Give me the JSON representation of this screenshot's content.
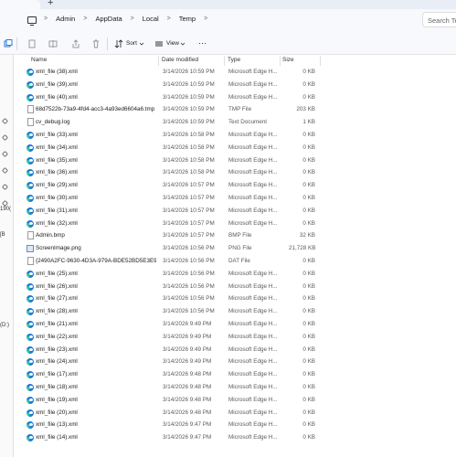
{
  "tabs": {
    "new_tab": "+"
  },
  "address": {
    "crumbs": [
      "Admin",
      "AppData",
      "Local",
      "Temp"
    ],
    "separator": ">",
    "search_placeholder": "Search Te"
  },
  "toolbar": {
    "sort_label": "Sort",
    "view_label": "View",
    "more_label": "···"
  },
  "gutter": {
    "snippets": [
      "190(",
      "[B",
      "(D:)"
    ]
  },
  "columns": {
    "name": "Name",
    "date": "Date modified",
    "type": "Type",
    "size": "Size"
  },
  "files": [
    {
      "name": "xml_file (38).xml",
      "date": "3/14/2026 10:59 PM",
      "type": "Microsoft Edge H...",
      "size": "0 KB",
      "icon": "edge-icon"
    },
    {
      "name": "xml_file (39).xml",
      "date": "3/14/2026 10:59 PM",
      "type": "Microsoft Edge H...",
      "size": "0 KB",
      "icon": "edge-icon"
    },
    {
      "name": "xml_file (40).xml",
      "date": "3/14/2026 10:59 PM",
      "type": "Microsoft Edge H...",
      "size": "0 KB",
      "icon": "edge-icon"
    },
    {
      "name": "68d7522b-73a9-4fd4-acc3-4a93ed6604a6.tmp",
      "date": "3/14/2026 10:59 PM",
      "type": "TMP File",
      "size": "203 KB",
      "icon": "document-icon"
    },
    {
      "name": "cv_debug.log",
      "date": "3/14/2026 10:59 PM",
      "type": "Text Document",
      "size": "1 KB",
      "icon": "document-icon"
    },
    {
      "name": "xml_file (33).xml",
      "date": "3/14/2026 10:58 PM",
      "type": "Microsoft Edge H...",
      "size": "0 KB",
      "icon": "edge-icon"
    },
    {
      "name": "xml_file (34).xml",
      "date": "3/14/2026 10:58 PM",
      "type": "Microsoft Edge H...",
      "size": "0 KB",
      "icon": "edge-icon"
    },
    {
      "name": "xml_file (35).xml",
      "date": "3/14/2026 10:58 PM",
      "type": "Microsoft Edge H...",
      "size": "0 KB",
      "icon": "edge-icon"
    },
    {
      "name": "xml_file (36).xml",
      "date": "3/14/2026 10:58 PM",
      "type": "Microsoft Edge H...",
      "size": "0 KB",
      "icon": "edge-icon"
    },
    {
      "name": "xml_file (29).xml",
      "date": "3/14/2026 10:57 PM",
      "type": "Microsoft Edge H...",
      "size": "0 KB",
      "icon": "edge-icon"
    },
    {
      "name": "xml_file (30).xml",
      "date": "3/14/2026 10:57 PM",
      "type": "Microsoft Edge H...",
      "size": "0 KB",
      "icon": "edge-icon"
    },
    {
      "name": "xml_file (31).xml",
      "date": "3/14/2026 10:57 PM",
      "type": "Microsoft Edge H...",
      "size": "0 KB",
      "icon": "edge-icon"
    },
    {
      "name": "xml_file (32).xml",
      "date": "3/14/2026 10:57 PM",
      "type": "Microsoft Edge H...",
      "size": "0 KB",
      "icon": "edge-icon"
    },
    {
      "name": "Admin.bmp",
      "date": "3/14/2026 10:57 PM",
      "type": "BMP File",
      "size": "32 KB",
      "icon": "document-icon"
    },
    {
      "name": "ScreenImage.png",
      "date": "3/14/2026 10:56 PM",
      "type": "PNG File",
      "size": "21,728 KB",
      "icon": "image-icon"
    },
    {
      "name": "{2490A2FC-9630-4D3A-979A-BDE52BD5E3E9} - ...",
      "date": "3/14/2026 10:56 PM",
      "type": "DAT File",
      "size": "0 KB",
      "icon": "document-icon"
    },
    {
      "name": "xml_file (25).xml",
      "date": "3/14/2026 10:56 PM",
      "type": "Microsoft Edge H...",
      "size": "0 KB",
      "icon": "edge-icon"
    },
    {
      "name": "xml_file (26).xml",
      "date": "3/14/2026 10:56 PM",
      "type": "Microsoft Edge H...",
      "size": "0 KB",
      "icon": "edge-icon"
    },
    {
      "name": "xml_file (27).xml",
      "date": "3/14/2026 10:56 PM",
      "type": "Microsoft Edge H...",
      "size": "0 KB",
      "icon": "edge-icon"
    },
    {
      "name": "xml_file (28).xml",
      "date": "3/14/2026 10:56 PM",
      "type": "Microsoft Edge H...",
      "size": "0 KB",
      "icon": "edge-icon"
    },
    {
      "name": "xml_file (21).xml",
      "date": "3/14/2026 9:49 PM",
      "type": "Microsoft Edge H...",
      "size": "0 KB",
      "icon": "edge-icon"
    },
    {
      "name": "xml_file (22).xml",
      "date": "3/14/2026 9:49 PM",
      "type": "Microsoft Edge H...",
      "size": "0 KB",
      "icon": "edge-icon"
    },
    {
      "name": "xml_file (23).xml",
      "date": "3/14/2026 9:49 PM",
      "type": "Microsoft Edge H...",
      "size": "0 KB",
      "icon": "edge-icon"
    },
    {
      "name": "xml_file (24).xml",
      "date": "3/14/2026 9:49 PM",
      "type": "Microsoft Edge H...",
      "size": "0 KB",
      "icon": "edge-icon"
    },
    {
      "name": "xml_file (17).xml",
      "date": "3/14/2026 9:48 PM",
      "type": "Microsoft Edge H...",
      "size": "0 KB",
      "icon": "edge-icon"
    },
    {
      "name": "xml_file (18).xml",
      "date": "3/14/2026 9:48 PM",
      "type": "Microsoft Edge H...",
      "size": "0 KB",
      "icon": "edge-icon"
    },
    {
      "name": "xml_file (19).xml",
      "date": "3/14/2026 9:48 PM",
      "type": "Microsoft Edge H...",
      "size": "0 KB",
      "icon": "edge-icon"
    },
    {
      "name": "xml_file (20).xml",
      "date": "3/14/2026 9:48 PM",
      "type": "Microsoft Edge H...",
      "size": "0 KB",
      "icon": "edge-icon"
    },
    {
      "name": "xml_file (13).xml",
      "date": "3/14/2026 9:47 PM",
      "type": "Microsoft Edge H...",
      "size": "0 KB",
      "icon": "edge-icon"
    },
    {
      "name": "xml_file (14).xml",
      "date": "3/14/2026 9:47 PM",
      "type": "Microsoft Edge H...",
      "size": "0 KB",
      "icon": "edge-icon"
    }
  ]
}
